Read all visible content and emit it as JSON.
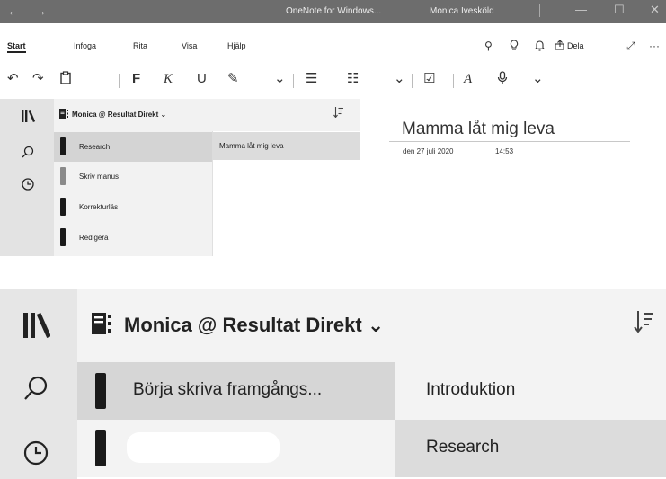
{
  "titlebar": {
    "back_glyph": "←",
    "forward_glyph": "→",
    "app_title": "OneNote for Windows...",
    "user_name": "Monica Ivesköld",
    "minimize_glyph": "—",
    "maximize_glyph": "☐",
    "close_glyph": "✕"
  },
  "menu": {
    "tabs": [
      "Start",
      "Infoga",
      "Rita",
      "Visa",
      "Hjälp"
    ],
    "icons": {
      "bulb": "⚲",
      "bell": "🔔︎",
      "share": "⇪",
      "expand": "⤢",
      "more": "···",
      "search": "⚲"
    },
    "share_label": "Dela"
  },
  "toolbar": {
    "undo": "↶",
    "redo": "↷",
    "clipboard": "📋︎",
    "bold": "F",
    "italic": "K",
    "underline": "U",
    "highlight": "✎",
    "dropdown": "⌄",
    "bullets": "☰",
    "numbering": "☷",
    "tag": "☑",
    "styles": "A",
    "dictate": "🎙︎"
  },
  "window1": {
    "rail_icons": {
      "library": "⫿\\",
      "search": "⚲",
      "recent": "◷"
    },
    "notebook_name": "Monica @ Resultat Direkt",
    "chevron": "⌄",
    "sort_glyph": "⇩",
    "sections": [
      {
        "label": "Research"
      },
      {
        "label": "Skriv manus"
      },
      {
        "label": "Korrekturläs"
      },
      {
        "label": "Redigera"
      }
    ],
    "pages": [
      {
        "label": "Mamma låt mig leva"
      }
    ],
    "page": {
      "title": "Mamma låt mig leva",
      "date": "den 27 juli 2020",
      "time": "14:53"
    }
  },
  "window2": {
    "rail_icons": {
      "library": "⫿\\",
      "search": "⚲",
      "recent": "◷"
    },
    "notebook_name": "Monica @ Resultat Direkt",
    "chevron": "⌄",
    "sort_glyph": "⇩",
    "sections": [
      {
        "label": "Börja skriva framgångs..."
      },
      {
        "label": ""
      }
    ],
    "pages": [
      {
        "label": "Introduktion"
      },
      {
        "label": "Research"
      }
    ]
  },
  "colors": {
    "titlebar": "#6d6d6d",
    "rail": "#e3e3e3",
    "panel": "#f2f2f2",
    "selected": "#d4d4d4",
    "page_selected": "#dcdcdc"
  }
}
